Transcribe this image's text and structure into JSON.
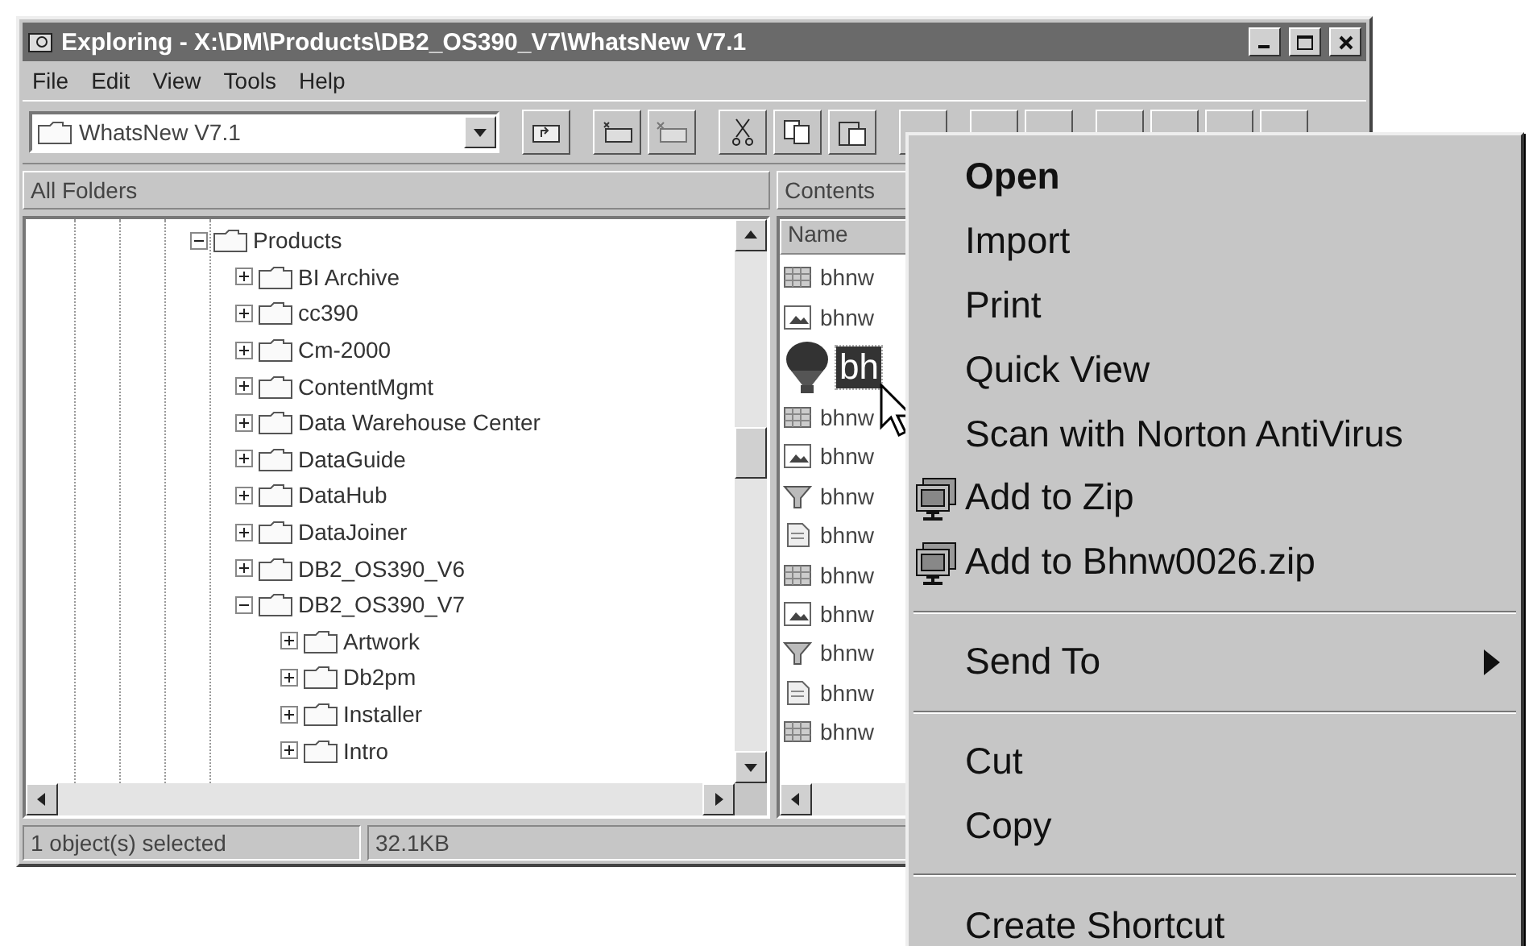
{
  "window": {
    "title": "Exploring - X:\\DM\\Products\\DB2_OS390_V7\\WhatsNew V7.1"
  },
  "menu_bar": [
    {
      "label": "File"
    },
    {
      "label": "Edit"
    },
    {
      "label": "View"
    },
    {
      "label": "Tools"
    },
    {
      "label": "Help"
    }
  ],
  "address": {
    "value": "WhatsNew V7.1"
  },
  "folders_header": "All Folders",
  "contents_header": "Contents",
  "tree": [
    {
      "label": "Products",
      "expanded": true,
      "children": [
        {
          "label": "BI Archive",
          "expanded": false
        },
        {
          "label": "cc390",
          "expanded": false
        },
        {
          "label": "Cm-2000",
          "expanded": false
        },
        {
          "label": "ContentMgmt",
          "expanded": false
        },
        {
          "label": "Data Warehouse Center",
          "expanded": false
        },
        {
          "label": "DataGuide",
          "expanded": false
        },
        {
          "label": "DataHub",
          "expanded": false
        },
        {
          "label": "DataJoiner",
          "expanded": false
        },
        {
          "label": "DB2_OS390_V6",
          "expanded": false
        },
        {
          "label": "DB2_OS390_V7",
          "expanded": true,
          "children": [
            {
              "label": "Artwork",
              "expanded": false
            },
            {
              "label": "Db2pm",
              "expanded": false
            },
            {
              "label": "Installer",
              "expanded": false
            },
            {
              "label": "Intro",
              "expanded": false
            }
          ]
        }
      ]
    }
  ],
  "files": {
    "column": "Name",
    "rows": [
      {
        "name": "bhnw",
        "kind": "sheet",
        "selected": false
      },
      {
        "name": "bhnw",
        "kind": "picture",
        "selected": false
      },
      {
        "name": "bh",
        "kind": "balloon",
        "selected": true
      },
      {
        "name": "bhnw",
        "kind": "sheet",
        "selected": false
      },
      {
        "name": "bhnw",
        "kind": "picture",
        "selected": false
      },
      {
        "name": "bhnw",
        "kind": "funnel",
        "selected": false
      },
      {
        "name": "bhnw",
        "kind": "doc",
        "selected": false
      },
      {
        "name": "bhnw",
        "kind": "sheet",
        "selected": false
      },
      {
        "name": "bhnw",
        "kind": "picture",
        "selected": false
      },
      {
        "name": "bhnw",
        "kind": "funnel",
        "selected": false
      },
      {
        "name": "bhnw",
        "kind": "doc",
        "selected": false
      },
      {
        "name": "bhnw",
        "kind": "sheet",
        "selected": false
      }
    ]
  },
  "status_bar": [
    "1 object(s) selected",
    "32.1KB"
  ],
  "context_menu": [
    {
      "kind": "item",
      "label": "Open",
      "default": true
    },
    {
      "kind": "item",
      "label": "Import",
      "default": false
    },
    {
      "kind": "item",
      "label": "Print",
      "default": false
    },
    {
      "kind": "item",
      "label": "Quick View",
      "default": false
    },
    {
      "kind": "item",
      "label": "Scan with Norton AntiVirus",
      "default": false
    },
    {
      "kind": "icon_item",
      "label": "Add to Zip",
      "default": false
    },
    {
      "kind": "icon_item",
      "label": "Add to Bhnw0026.zip",
      "default": false
    },
    {
      "kind": "separator"
    },
    {
      "kind": "submenu",
      "label": "Send To",
      "default": false
    },
    {
      "kind": "separator"
    },
    {
      "kind": "item",
      "label": "Cut",
      "default": false
    },
    {
      "kind": "item",
      "label": "Copy",
      "default": false
    },
    {
      "kind": "separator"
    },
    {
      "kind": "item",
      "label": "Create Shortcut",
      "default": false
    }
  ]
}
